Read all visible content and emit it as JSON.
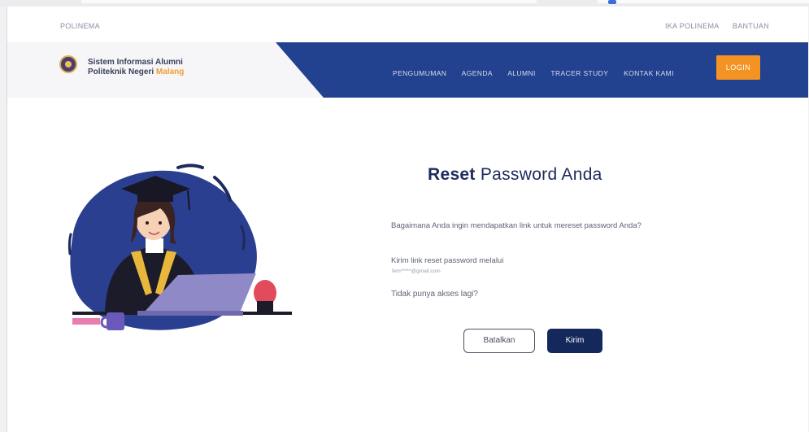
{
  "topbar": {
    "brand": "POLINEMA",
    "links": [
      "IKA POLINEMA",
      "BANTUAN"
    ]
  },
  "header": {
    "site_name_line1": "Sistem Informasi Alumni",
    "site_name_line2_prefix": "Politeknik Negeri ",
    "site_name_line2_accent": "Malang",
    "nav": [
      "PENGUMUMAN",
      "AGENDA",
      "ALUMNI",
      "TRACER STUDY",
      "KONTAK KAMI"
    ],
    "login_label": "LOGIN"
  },
  "reset": {
    "title_bold": "Reset",
    "title_rest": " Password Anda",
    "question": "Bagaimana Anda ingin mendapatkan link untuk mereset password Anda?",
    "send_via": "Kirim link reset password melalui",
    "email_masked": "fem*****@gmail.com",
    "no_access": "Tidak punya akses lagi?",
    "cancel_label": "Batalkan",
    "send_label": "Kirim"
  },
  "colors": {
    "primary": "#22418e",
    "accent": "#f39323",
    "dark_button": "#14285b"
  }
}
